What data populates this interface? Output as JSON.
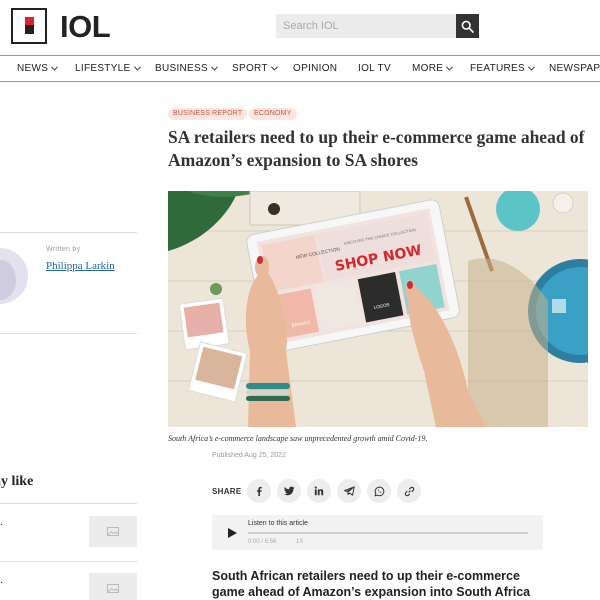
{
  "brand": {
    "name": "IOL",
    "accent": "#d8262b"
  },
  "search": {
    "placeholder": "Search IOL",
    "icon": "search-icon"
  },
  "nav": {
    "items": [
      {
        "label": "NEWS",
        "dropdown": true
      },
      {
        "label": "LIFESTYLE",
        "dropdown": true
      },
      {
        "label": "BUSINESS",
        "dropdown": true
      },
      {
        "label": "SPORT",
        "dropdown": true
      },
      {
        "label": "OPINION",
        "dropdown": false
      },
      {
        "label": "IOL TV",
        "dropdown": false
      },
      {
        "label": "MORE",
        "dropdown": true
      },
      {
        "label": "FEATURES",
        "dropdown": true
      },
      {
        "label": "NEWSPAPE",
        "dropdown": false
      }
    ]
  },
  "article": {
    "tags": [
      "BUSINESS REPORT",
      "ECONOMY"
    ],
    "headline": "SA retailers need to up their e-commerce game ahead of Amazon’s expansion to SA shores",
    "image_text": {
      "new_collection": "NEW COLLECTION",
      "discover": "DISCOVER THE CHOICE COLLECTION",
      "shop_now": "SHOP NOW",
      "brands": "BRANDS",
      "logos": "LOGOS"
    },
    "caption": "South Africa’s e-commerce landscape saw unprecedented growth amid Covid-19.",
    "published": "Published Aug 25, 2022",
    "lede": "South African retailers need to up their e-commerce game ahead of Amazon’s expansion into South Africa"
  },
  "author": {
    "written_by": "Written by",
    "name": "Philippa Larkin"
  },
  "share": {
    "label": "SHARE",
    "buttons": [
      "facebook-icon",
      "twitter-icon",
      "linkedin-icon",
      "telegram-icon",
      "whatsapp-icon",
      "link-icon"
    ]
  },
  "audio": {
    "title": "Listen to this article",
    "time": "0:00 / 6:56",
    "speed": "1X"
  },
  "sidebar": {
    "heading": "ay like",
    "items": [
      {
        "text": "."
      },
      {
        "text": "."
      }
    ]
  },
  "colors": {
    "tag_bg": "#fbe6e2",
    "tag_text": "#c8553f",
    "author_link": "#2166a6"
  }
}
